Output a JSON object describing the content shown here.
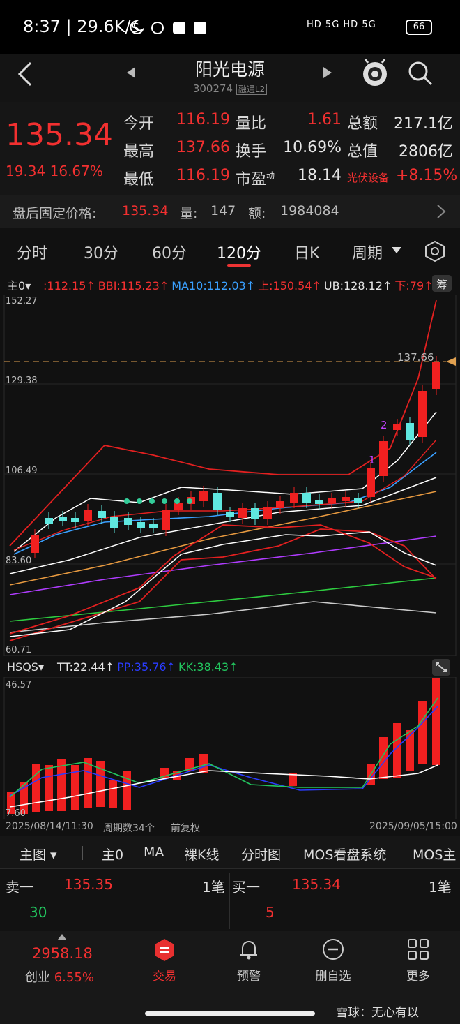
{
  "status": {
    "time": "8:37",
    "speed": "29.6K/s",
    "signal": "HD 5G HD 5G",
    "battery": "66"
  },
  "nav": {
    "title": "阳光电源",
    "code": "300274",
    "badge": "融通L2"
  },
  "quote": {
    "price": "135.34",
    "change": "19.34",
    "change_pct": "16.67%",
    "rows": [
      [
        {
          "l": "今开",
          "v": "116.19"
        },
        {
          "l": "量比",
          "v": "1.61"
        },
        {
          "l": "总额",
          "v": "217.1亿"
        }
      ],
      [
        {
          "l": "最高",
          "v": "137.66"
        },
        {
          "l": "换手",
          "v": "10.69%"
        },
        {
          "l": "总值",
          "v": "2806亿"
        }
      ],
      [
        {
          "l": "最低",
          "v": "116.19"
        },
        {
          "l": "市盈",
          "sup": "动",
          "v": "18.14"
        },
        {
          "l": "光伏设备",
          "v": "+8.15%"
        }
      ]
    ]
  },
  "after_hours": {
    "label": "盘后固定价格:",
    "price": "135.34",
    "vol_label": "量:",
    "vol": "147",
    "amt_label": "额:",
    "amt": "1984084"
  },
  "tabs": [
    "分时",
    "30分",
    "60分",
    "120分",
    "日K",
    "周期"
  ],
  "main_chart": {
    "selector": "主0",
    "indicators": [
      {
        "text": ":112.15",
        "color": "#f23030"
      },
      {
        "text": "BBI:115.23",
        "color": "#f23030"
      },
      {
        "text": "MA10:112.03",
        "color": "#3aa0ff"
      },
      {
        "text": "上:150.54",
        "color": "#f23030"
      },
      {
        "text": "UB:128.12",
        "color": "#e6e6e6"
      },
      {
        "text": "下:79",
        "color": "#f23030"
      }
    ],
    "right_btn": "筹",
    "y_labels": [
      "152.27",
      "129.38",
      "106.49",
      "83.60",
      "60.71"
    ],
    "high_label": "137.66",
    "markers": [
      "1",
      "2"
    ]
  },
  "sub_chart": {
    "selector": "HSQS",
    "indicators": [
      {
        "text": "TT:22.44",
        "color": "#e6e6e6"
      },
      {
        "text": "PP:35.76",
        "color": "#2a3cff"
      },
      {
        "text": "KK:38.43",
        "color": "#22c55e"
      }
    ],
    "y_top": "46.57",
    "y_bottom": "7.60",
    "date_start": "2025/08/14/11:30",
    "period_count": "周期数34个",
    "adjust": "前复权",
    "date_end": "2025/09/05/15:00"
  },
  "func_bar": [
    "主图",
    "主0",
    "MA",
    "裸K线",
    "分时图",
    "MOS看盘系统",
    "MOS主"
  ],
  "orderbook": {
    "sell_label": "卖一",
    "sell_price": "135.35",
    "sell_count": "1笔",
    "sell_vol": "30",
    "buy_label": "买一",
    "buy_price": "135.34",
    "buy_count": "1笔",
    "buy_vol": "5"
  },
  "bottom_nav": {
    "index_value": "2958.18",
    "index_name": "创业",
    "index_pct": "6.55%",
    "items": [
      "交易",
      "预警",
      "删自选",
      "更多"
    ]
  },
  "watermark": "雪球：无心有以"
}
